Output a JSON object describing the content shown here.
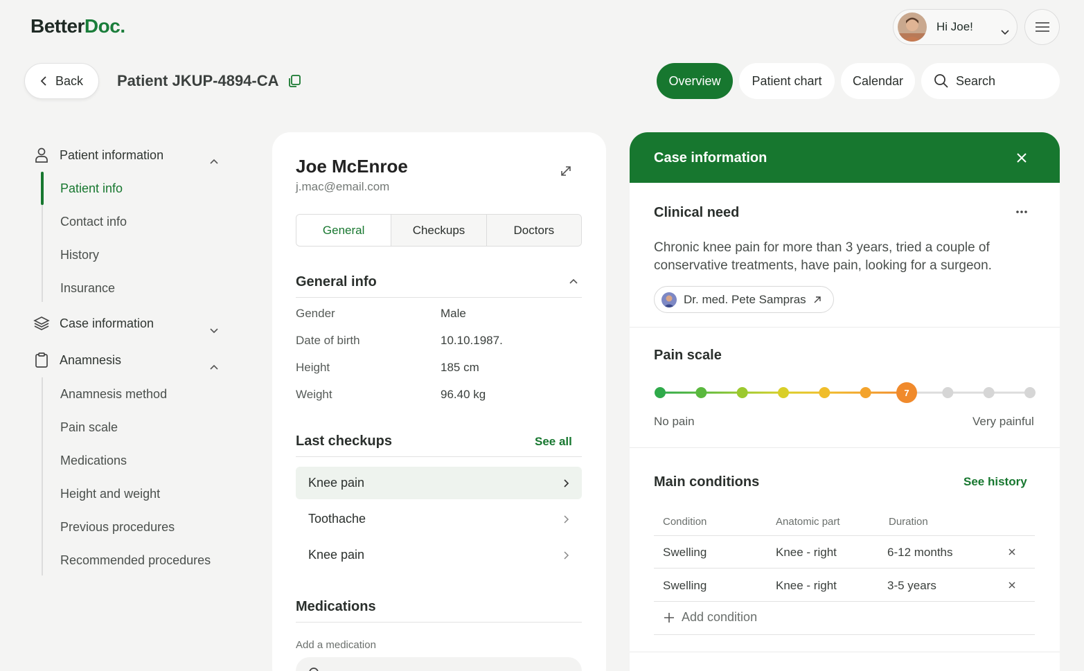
{
  "header": {
    "logo_part1": "Better",
    "logo_part2": "Doc",
    "logo_dot": ".",
    "greeting": "Hi Joe!",
    "back_label": "Back",
    "patient_title": "Patient JKUP-4894-CA"
  },
  "nav": {
    "overview": "Overview",
    "patient_chart": "Patient chart",
    "calendar": "Calendar",
    "search": "Search"
  },
  "sidebar": {
    "patient_information": "Patient information",
    "patient_items": [
      "Patient info",
      "Contact info",
      "History",
      "Insurance"
    ],
    "case_information": "Case information",
    "anamnesis": "Anamnesis",
    "anamnesis_items": [
      "Anamnesis method",
      "Pain scale",
      "Medications",
      "Height and weight",
      "Previous procedures",
      "Recommended procedures"
    ]
  },
  "patient": {
    "name": "Joe McEnroe",
    "email": "j.mac@email.com",
    "tabs": [
      "General",
      "Checkups",
      "Doctors"
    ],
    "general_info_title": "General info",
    "info": [
      {
        "label": "Gender",
        "value": "Male"
      },
      {
        "label": "Date of birth",
        "value": "10.10.1987."
      },
      {
        "label": "Height",
        "value": "185 cm"
      },
      {
        "label": "Weight",
        "value": "96.40 kg"
      }
    ],
    "last_checkups_title": "Last checkups",
    "see_all": "See all",
    "checkups": [
      "Knee pain",
      "Toothache",
      "Knee pain"
    ],
    "medications_title": "Medications",
    "add_medication_label": "Add a medication"
  },
  "case": {
    "title": "Case information",
    "clinical_need_title": "Clinical need",
    "clinical_need_text": "Chronic knee pain for more than 3 years, tried a couple of conservative treatments, have pain, looking for a surgeon.",
    "doctor": "Dr. med. Pete Sampras",
    "pain_scale_title": "Pain scale",
    "pain_value": 7,
    "pain_max": 10,
    "pain_min_label": "No pain",
    "pain_max_label": "Very painful",
    "main_conditions_title": "Main conditions",
    "see_history": "See history",
    "columns": [
      "Condition",
      "Anatomic part",
      "Duration"
    ],
    "conditions": [
      {
        "condition": "Swelling",
        "part": "Knee - right",
        "duration": "6-12 months"
      },
      {
        "condition": "Swelling",
        "part": "Knee - right",
        "duration": "3-5 years"
      }
    ],
    "add_condition": "Add condition"
  },
  "colors": {
    "brand": "#17772f",
    "pain_active": "#f08a2c"
  }
}
